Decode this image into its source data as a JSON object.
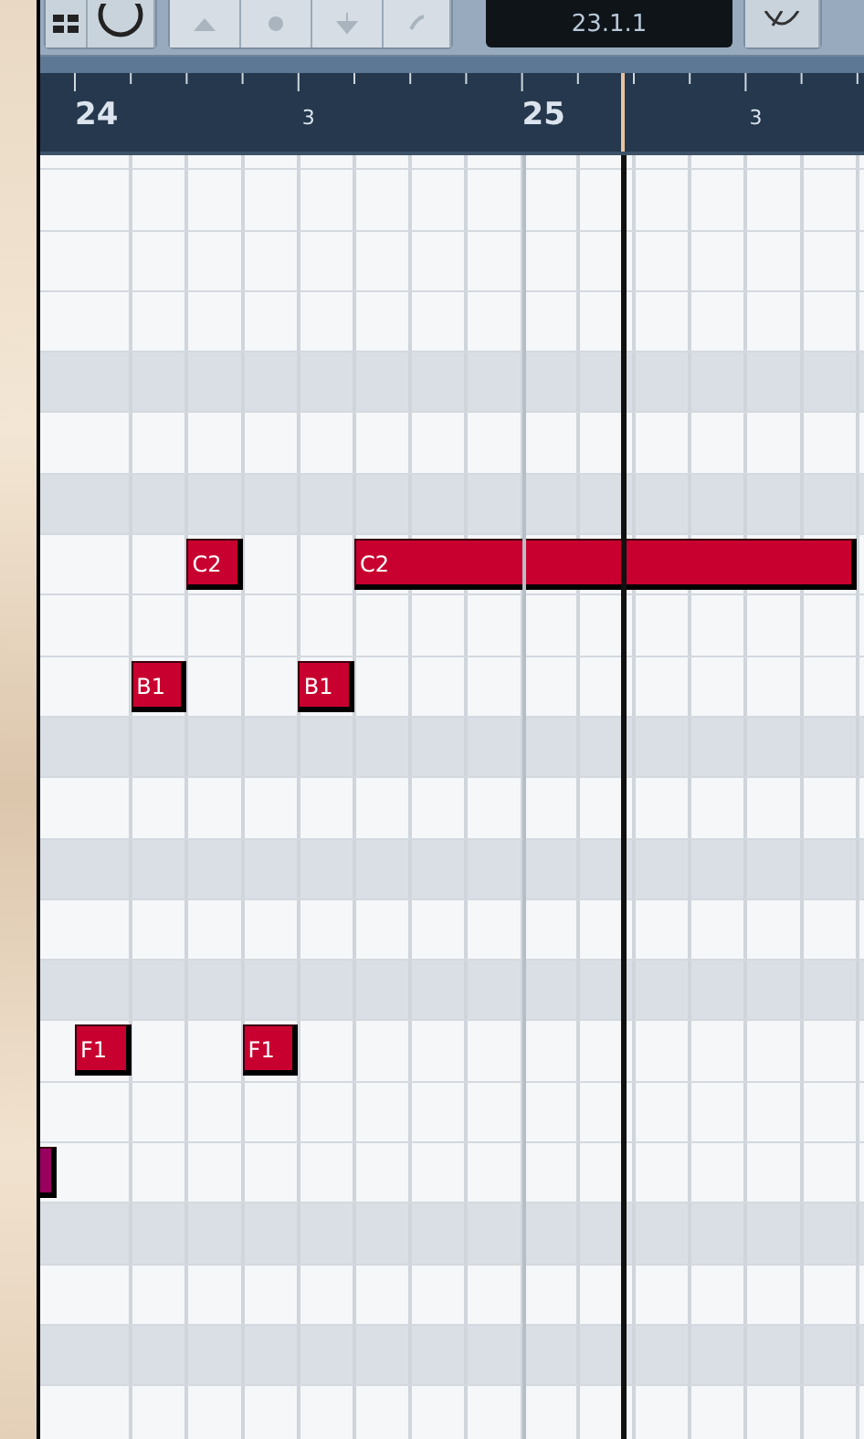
{
  "toolbar": {
    "position_display": "23.1.1"
  },
  "ruler": {
    "marks": [
      {
        "label": "24",
        "kind": "bar"
      },
      {
        "label": "3",
        "kind": "beat"
      },
      {
        "label": "25",
        "kind": "bar"
      },
      {
        "label": "3",
        "kind": "beat"
      }
    ]
  },
  "grid": {
    "rows": [
      {
        "shaded": false,
        "notes": []
      },
      {
        "shaded": false,
        "notes": []
      },
      {
        "shaded": false,
        "notes": []
      },
      {
        "shaded": false,
        "notes": []
      },
      {
        "shaded": true,
        "notes": []
      },
      {
        "shaded": false,
        "notes": []
      },
      {
        "shaded": true,
        "notes": []
      },
      {
        "shaded": false,
        "notes": [
          {
            "label": "C2",
            "color": "#c8002f"
          },
          {
            "label": "C2",
            "color": "#c8002f"
          }
        ]
      },
      {
        "shaded": false,
        "notes": []
      },
      {
        "shaded": false,
        "notes": [
          {
            "label": "B1",
            "color": "#c8002f"
          },
          {
            "label": "B1",
            "color": "#c8002f"
          }
        ]
      },
      {
        "shaded": true,
        "notes": []
      },
      {
        "shaded": false,
        "notes": []
      },
      {
        "shaded": true,
        "notes": []
      },
      {
        "shaded": false,
        "notes": []
      },
      {
        "shaded": true,
        "notes": []
      },
      {
        "shaded": false,
        "notes": [
          {
            "label": "F1",
            "color": "#c8002f"
          },
          {
            "label": "F1",
            "color": "#c8002f"
          }
        ]
      },
      {
        "shaded": false,
        "notes": []
      },
      {
        "shaded": false,
        "notes": [
          {
            "color": "#99005e"
          }
        ]
      },
      {
        "shaded": true,
        "notes": []
      },
      {
        "shaded": false,
        "notes": []
      },
      {
        "shaded": true,
        "notes": []
      },
      {
        "shaded": false,
        "notes": []
      }
    ]
  }
}
